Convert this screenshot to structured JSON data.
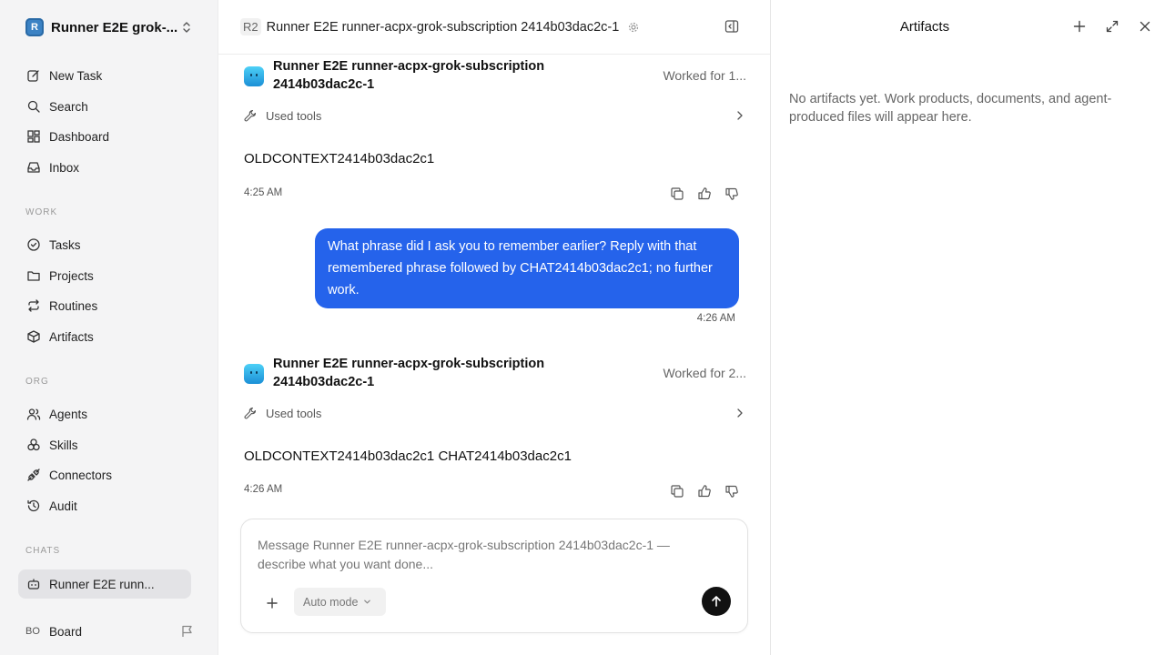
{
  "workspace": {
    "logo_letter": "R",
    "name": "Runner E2E grok-..."
  },
  "nav_primary": [
    {
      "label": "New Task",
      "icon": "edit-icon"
    },
    {
      "label": "Search",
      "icon": "search-icon"
    },
    {
      "label": "Dashboard",
      "icon": "dashboard-icon"
    },
    {
      "label": "Inbox",
      "icon": "inbox-icon"
    }
  ],
  "sections": {
    "work": "WORK",
    "org": "ORG",
    "chats": "CHATS"
  },
  "nav_work": [
    {
      "label": "Tasks",
      "icon": "check-circle-icon"
    },
    {
      "label": "Projects",
      "icon": "folder-icon"
    },
    {
      "label": "Routines",
      "icon": "repeat-icon"
    },
    {
      "label": "Artifacts",
      "icon": "box-icon"
    }
  ],
  "nav_org": [
    {
      "label": "Agents",
      "icon": "users-icon"
    },
    {
      "label": "Skills",
      "icon": "skills-icon"
    },
    {
      "label": "Connectors",
      "icon": "plug-icon"
    },
    {
      "label": "Audit",
      "icon": "history-icon"
    }
  ],
  "chats": [
    {
      "label": "Runner E2E runn...",
      "icon": "bot-icon",
      "active": true
    }
  ],
  "footer": {
    "initials": "BO",
    "label": "Board"
  },
  "header": {
    "badge": "R2",
    "title": "Runner E2E runner-acpx-grok-subscription 2414b03dac2c-1"
  },
  "messages": {
    "agent1": {
      "name": "Runner E2E runner-acpx-grok-subscription 2414b03dac2c-1",
      "worked": "Worked for 1...",
      "tools_label": "Used tools",
      "text": "OLDCONTEXT2414b03dac2c1",
      "time": "4:25 AM"
    },
    "user1": {
      "text": "What phrase did I ask you to remember earlier? Reply with that remembered phrase followed by CHAT2414b03dac2c1; no further work.",
      "time": "4:26 AM"
    },
    "agent2": {
      "name": "Runner E2E runner-acpx-grok-subscription 2414b03dac2c-1",
      "worked": "Worked for 2...",
      "tools_label": "Used tools",
      "text": "OLDCONTEXT2414b03dac2c1 CHAT2414b03dac2c1",
      "time": "4:26 AM"
    }
  },
  "composer": {
    "placeholder": "Message Runner E2E runner-acpx-grok-subscription 2414b03dac2c-1 — describe what you want done...",
    "mode": "Auto mode"
  },
  "artifacts": {
    "title": "Artifacts",
    "empty": "No artifacts yet. Work products, documents, and agent-produced files will appear here."
  },
  "colors": {
    "accent": "#2563eb",
    "sidebar_bg": "#f4f4f5",
    "active_item": "#e3e3e6"
  }
}
